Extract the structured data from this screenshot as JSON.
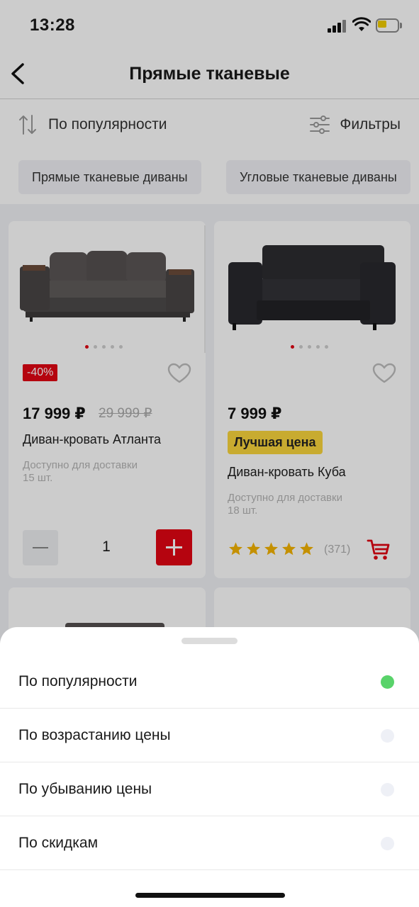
{
  "status": {
    "time": "13:28"
  },
  "nav": {
    "title": "Прямые тканевые"
  },
  "toolbar": {
    "sort_label": "По популярности",
    "filter_label": "Фильтры"
  },
  "chips": [
    "Прямые тканевые диваны",
    "Угловые тканевые диваны"
  ],
  "products": [
    {
      "discount": "-40%",
      "price": "17 999 ₽",
      "old_price": "29 999 ₽",
      "title": "Диван-кровать Атланта",
      "availability": "Доступно для доставки",
      "stock": "15 шт.",
      "quantity": "1"
    },
    {
      "price": "7 999 ₽",
      "badge": "Лучшая цена",
      "title": "Диван-кровать Куба",
      "availability": "Доступно для доставки",
      "stock": "18 шт.",
      "rating": 5,
      "reviews": "(371)"
    }
  ],
  "sort_sheet": {
    "options": [
      {
        "label": "По популярности",
        "selected": true
      },
      {
        "label": "По возрастанию цены",
        "selected": false
      },
      {
        "label": "По убыванию цены",
        "selected": false
      },
      {
        "label": "По скидкам",
        "selected": false
      }
    ]
  },
  "colors": {
    "accent_red": "#e30613",
    "badge_yellow": "#fbd63d",
    "selected_green": "#59d36a",
    "star": "#f5b400"
  }
}
